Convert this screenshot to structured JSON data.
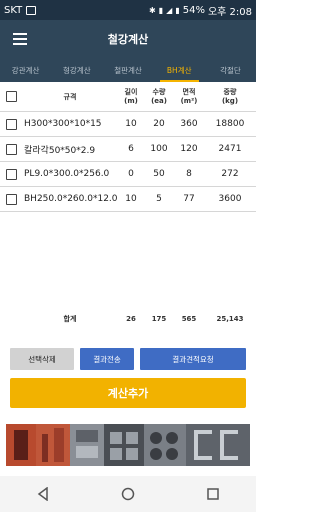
{
  "status_bar": {
    "carrier": "SKT",
    "battery": "54%",
    "time": "오후 2:08"
  },
  "app_bar": {
    "title": "철강계산"
  },
  "tabs": [
    {
      "label": "강관계산",
      "active": false
    },
    {
      "label": "형강계산",
      "active": false
    },
    {
      "label": "철판계산",
      "active": false
    },
    {
      "label": "BH계산",
      "active": true
    },
    {
      "label": "각절단",
      "active": false
    }
  ],
  "table": {
    "headers": {
      "spec": "규격",
      "length": [
        "길이",
        "(m)"
      ],
      "qty": [
        "수량",
        "(ea)"
      ],
      "area": [
        "면적",
        "(m²)"
      ],
      "weight": [
        "중량",
        "(kg)"
      ]
    },
    "rows": [
      {
        "spec": "H300*300*10*15",
        "length": "10",
        "qty": "20",
        "area": "360",
        "weight": "18800"
      },
      {
        "spec": "칼라각50*50*2.9",
        "length": "6",
        "qty": "100",
        "area": "120",
        "weight": "2471"
      },
      {
        "spec": "PL9.0*300.0*256.0",
        "length": "0",
        "qty": "50",
        "area": "8",
        "weight": "272"
      },
      {
        "spec": "BH250.0*260.0*12.0",
        "length": "10",
        "qty": "5",
        "area": "77",
        "weight": "3600"
      }
    ]
  },
  "totals": {
    "label": "합계",
    "length": "26",
    "qty": "175",
    "area": "565",
    "weight": "25,143"
  },
  "buttons": {
    "delete_selected": "선택삭제",
    "send_results": "결과전송",
    "request_quote": "결과견적요청",
    "add_calc": "계산추가"
  },
  "colors": {
    "status_bar": "#1f3244",
    "app_bar": "#2f4659",
    "tab_active": "#f5b400",
    "button_blue": "#3f6cc4",
    "button_yellow": "#f2b200",
    "button_gray": "#d2d2d2"
  }
}
